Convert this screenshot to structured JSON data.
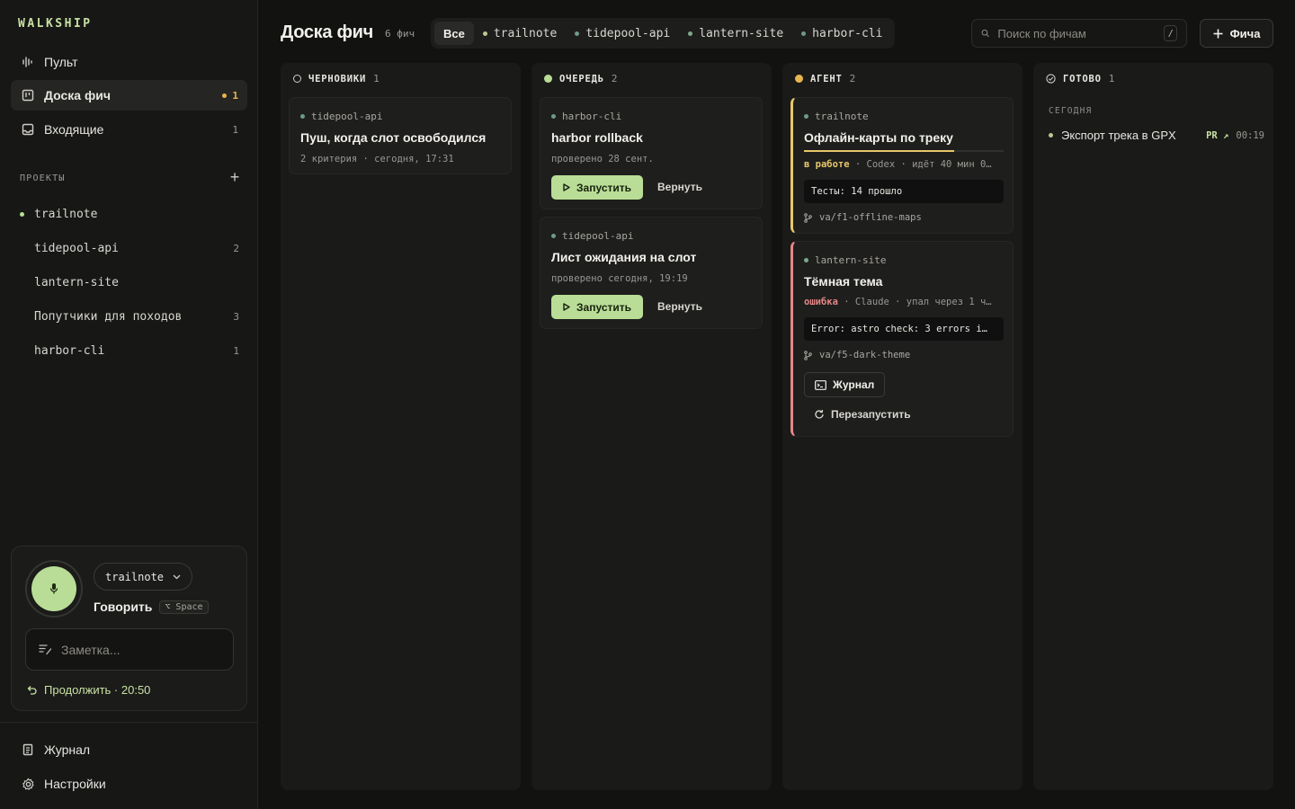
{
  "brand": "WALKSHIP",
  "nav": {
    "dashboard": "Пульт",
    "board": "Доска фич",
    "board_count": "1",
    "inbox": "Входящие",
    "inbox_count": "1"
  },
  "projects": {
    "title": "ПРОЕКТЫ",
    "items": [
      {
        "name": "trailnote",
        "count": "",
        "active": true
      },
      {
        "name": "tidepool-api",
        "count": "2"
      },
      {
        "name": "lantern-site",
        "count": ""
      },
      {
        "name": "Попутчики для походов",
        "count": "3"
      },
      {
        "name": "harbor-cli",
        "count": "1"
      }
    ]
  },
  "voice": {
    "project": "trailnote",
    "speak": "Говорить",
    "shortcut": "⌥ Space",
    "note_placeholder": "Заметка...",
    "continue": "Продолжить · 20:50"
  },
  "footer_nav": {
    "journal": "Журнал",
    "settings": "Настройки"
  },
  "header": {
    "title": "Доска фич",
    "count": "6 фич",
    "filters": [
      "Все",
      "trailnote",
      "tidepool-api",
      "lantern-site",
      "harbor-cli"
    ],
    "search_placeholder": "Поиск по фичам",
    "search_shortcut": "/",
    "new_button": "Фича"
  },
  "columns": {
    "drafts": {
      "title": "ЧЕРНОВИКИ",
      "count": "1",
      "cards": [
        {
          "project": "tidepool-api",
          "title": "Пуш, когда слот освободился",
          "meta": "2 критерия · сегодня, 17:31"
        }
      ]
    },
    "queue": {
      "title": "ОЧЕРЕДЬ",
      "count": "2",
      "run_label": "Запустить",
      "back_label": "Вернуть",
      "cards": [
        {
          "project": "harbor-cli",
          "title": "harbor rollback",
          "meta": "проверено 28 сент."
        },
        {
          "project": "tidepool-api",
          "title": "Лист ожидания на слот",
          "meta": "проверено сегодня, 19:19"
        }
      ]
    },
    "agent": {
      "title": "АГЕНТ",
      "count": "2",
      "cards": [
        {
          "project": "trailnote",
          "title": "Офлайн-карты по треку",
          "status": "в работе",
          "status_rest": " · Codex · идёт 40 мин 0…",
          "progress": 0.75,
          "terminal": "Тесты: 14 прошло",
          "branch": "va/f1-offline-maps"
        },
        {
          "project": "lantern-site",
          "title": "Тёмная тема",
          "status": "ошибка",
          "status_rest": " · Claude · упал через 1 ч…",
          "terminal": "Error: astro check: 3 errors i…",
          "branch": "va/f5-dark-theme",
          "journal": "Журнал",
          "restart": "Перезапустить"
        }
      ]
    },
    "done": {
      "title": "ГОТОВО",
      "count": "1",
      "section": "СЕГОДНЯ",
      "items": [
        {
          "title": "Экспорт трека в GPX",
          "pr": "PR ↗",
          "time": "00:19"
        }
      ]
    }
  },
  "colors": {
    "accent_green": "#b9dd96",
    "accent_yellow": "#e7c76a",
    "error_red": "#e58686",
    "queue_dot": "#b9dd96",
    "agent_dot": "#e7b64f",
    "project_dot": "#6f9a8a"
  }
}
